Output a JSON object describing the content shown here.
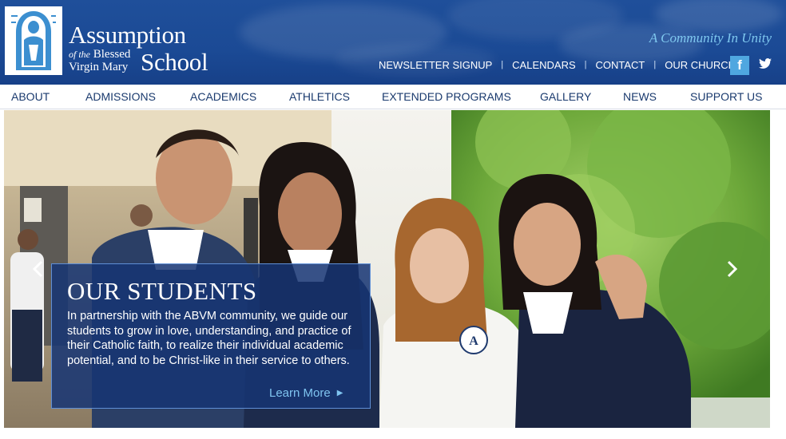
{
  "header": {
    "logo_line1": "Assumption",
    "logo_line2_italic": "of the",
    "logo_line2": "Blessed",
    "logo_line3": "Virgin Mary",
    "logo_school": "School",
    "tagline": "A Community In Unity",
    "utility_links": [
      {
        "label": "NEWSLETTER SIGNUP"
      },
      {
        "label": "CALENDARS"
      },
      {
        "label": "CONTACT"
      },
      {
        "label": "OUR CHURCH"
      }
    ],
    "facebook_label": "f",
    "colors": {
      "header_blue": "#1b4a95",
      "tagline_blue": "#7fc8ef",
      "nav_text": "#1a3a6e"
    }
  },
  "main_nav": [
    {
      "label": "ABOUT"
    },
    {
      "label": "ADMISSIONS"
    },
    {
      "label": "ACADEMICS"
    },
    {
      "label": "ATHLETICS"
    },
    {
      "label": "EXTENDED PROGRAMS"
    },
    {
      "label": "GALLERY"
    },
    {
      "label": "NEWS"
    },
    {
      "label": "SUPPORT US"
    }
  ],
  "hero": {
    "title": "OUR STUDENTS",
    "body": "In partnership with the ABVM community, we guide our students to grow in love, understanding, and practice of their Catholic faith, to realize their individual academic potential, and to be Christ-like in their service to others.",
    "cta": "Learn More",
    "crest_letter": "A",
    "icons": {
      "prev": "chevron-left-icon",
      "next": "chevron-right-icon",
      "cta_arrow": "caret-right-icon",
      "twitter": "twitter-icon",
      "facebook": "facebook-icon"
    }
  }
}
